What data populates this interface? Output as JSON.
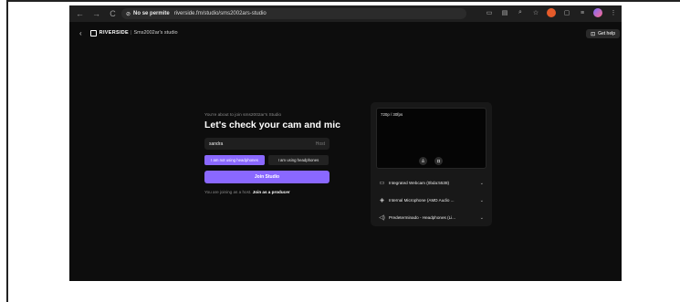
{
  "browser": {
    "back_glyph": "←",
    "forward_glyph": "→",
    "reload_glyph": "C",
    "permission_label": "No se permite",
    "url": "riverside.fm/studio/sms2002ars-studio"
  },
  "app": {
    "back_glyph": "‹",
    "brand": "RIVERSIDE",
    "separator": "|",
    "studio_name": "Sms2002ar's studio",
    "help_label": "Get help"
  },
  "join": {
    "intro": "You're about to join sms2002ar's Studio",
    "heading": "Let's check your cam and mic",
    "name_value": "sandra",
    "name_role": "Host",
    "headphones_options": [
      "I am not using headphones",
      "I am using headphones"
    ],
    "headphones_selected": 0,
    "join_button": "Join Studio",
    "joining_prefix": "You are joining as a host.",
    "joining_link": "Join as a producer"
  },
  "preview": {
    "resolution": "720p / 30fps"
  },
  "devices": [
    {
      "icon": "camera-icon",
      "glyph": "▭",
      "label": "Integrated Webcam (0bda:5538)"
    },
    {
      "icon": "microphone-icon",
      "glyph": "◈",
      "label": "Internal Microphone (AMD Audio ..."
    },
    {
      "icon": "speaker-icon",
      "glyph": "◁)",
      "label": "Predeterminado - Headphones (Li..."
    }
  ],
  "colors": {
    "accent": "#8a68ff",
    "page_bg": "#0d0d0d",
    "panel_bg": "#181818"
  }
}
